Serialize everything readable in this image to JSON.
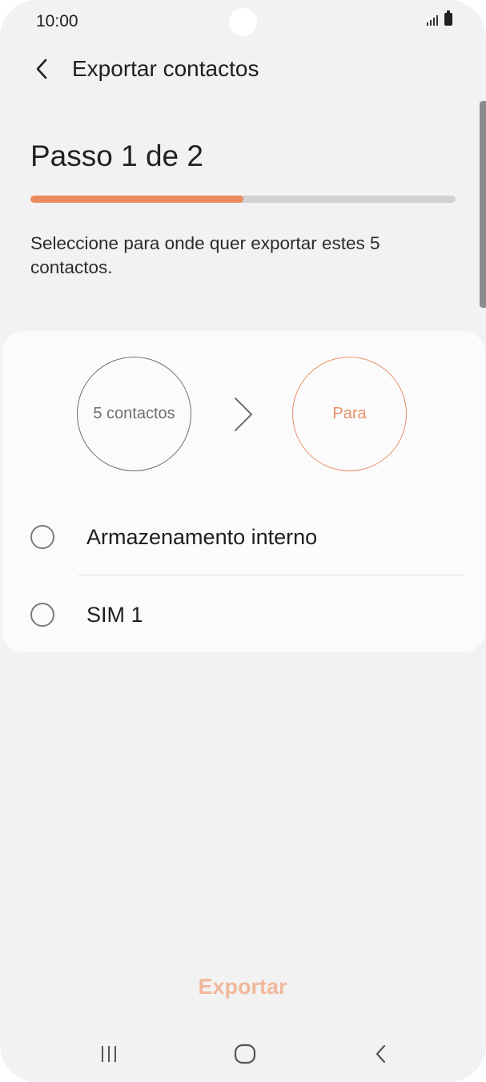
{
  "status_bar": {
    "time": "10:00",
    "icons": [
      "signal-icon",
      "battery-icon"
    ]
  },
  "header": {
    "title": "Exportar contactos",
    "back_icon": "back-arrow-icon"
  },
  "step": {
    "title": "Passo 1 de 2",
    "progress_fraction": 0.5,
    "instruction": "Seleccione para onde quer exportar estes 5 contactos."
  },
  "card": {
    "source_label": "5 contactos",
    "arrow_icon": "chevron-right-icon",
    "destination_label": "Para",
    "options": [
      {
        "label": "Armazenamento interno",
        "selected": false
      },
      {
        "label": "SIM 1",
        "selected": false
      }
    ]
  },
  "actions": {
    "export_label": "Exportar"
  },
  "nav_bar": {
    "icons": [
      "recent-apps-icon",
      "home-icon",
      "back-icon"
    ]
  },
  "colors": {
    "accent": "#ec8b5e",
    "accent_disabled": "#f2b79b",
    "background": "#f2f2f2",
    "card": "#fbfbfb"
  }
}
